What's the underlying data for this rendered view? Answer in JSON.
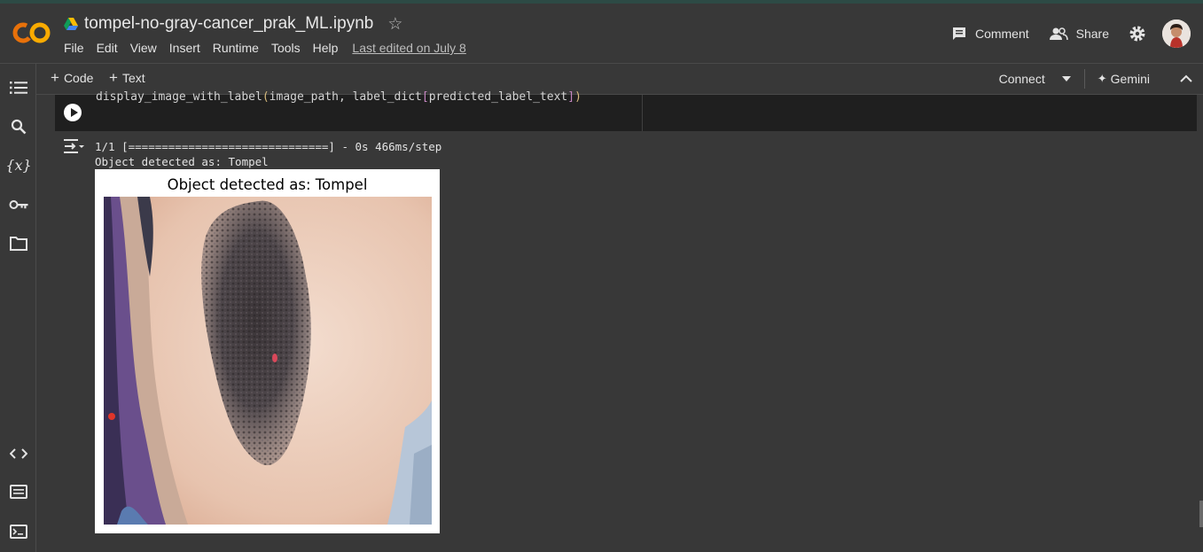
{
  "app": {
    "logo": "CO",
    "notebook_title": "tompel-no-gray-cancer_prak_ML.ipynb",
    "drive_icon": "google-drive-icon",
    "star_icon": "star-outline-icon"
  },
  "menu": {
    "items": [
      "File",
      "Edit",
      "View",
      "Insert",
      "Runtime",
      "Tools",
      "Help"
    ],
    "last_edited": "Last edited on July 8"
  },
  "header_actions": {
    "comment": "Comment",
    "share": "Share"
  },
  "toolbar": {
    "add_code": "Code",
    "add_text": "Text",
    "connect": "Connect",
    "gemini": "Gemini"
  },
  "cell": {
    "code": {
      "func": "display_image_with_label",
      "open": "(",
      "arg1": "image_path, label_dict",
      "lb": "[",
      "arg2": "predicted_label_text",
      "rb": "]",
      "close": ")"
    },
    "output": {
      "progress_line": "1/1 [==============================] - 0s 466ms/step",
      "result_line": "Object detected as: Tompel",
      "figure_title": "Object detected as: Tompel"
    }
  },
  "colors": {
    "background": "#383838",
    "code_cell": "#1f1f1f",
    "logo_orange": "#f9ab00",
    "logo_dark_orange": "#e8710a"
  }
}
